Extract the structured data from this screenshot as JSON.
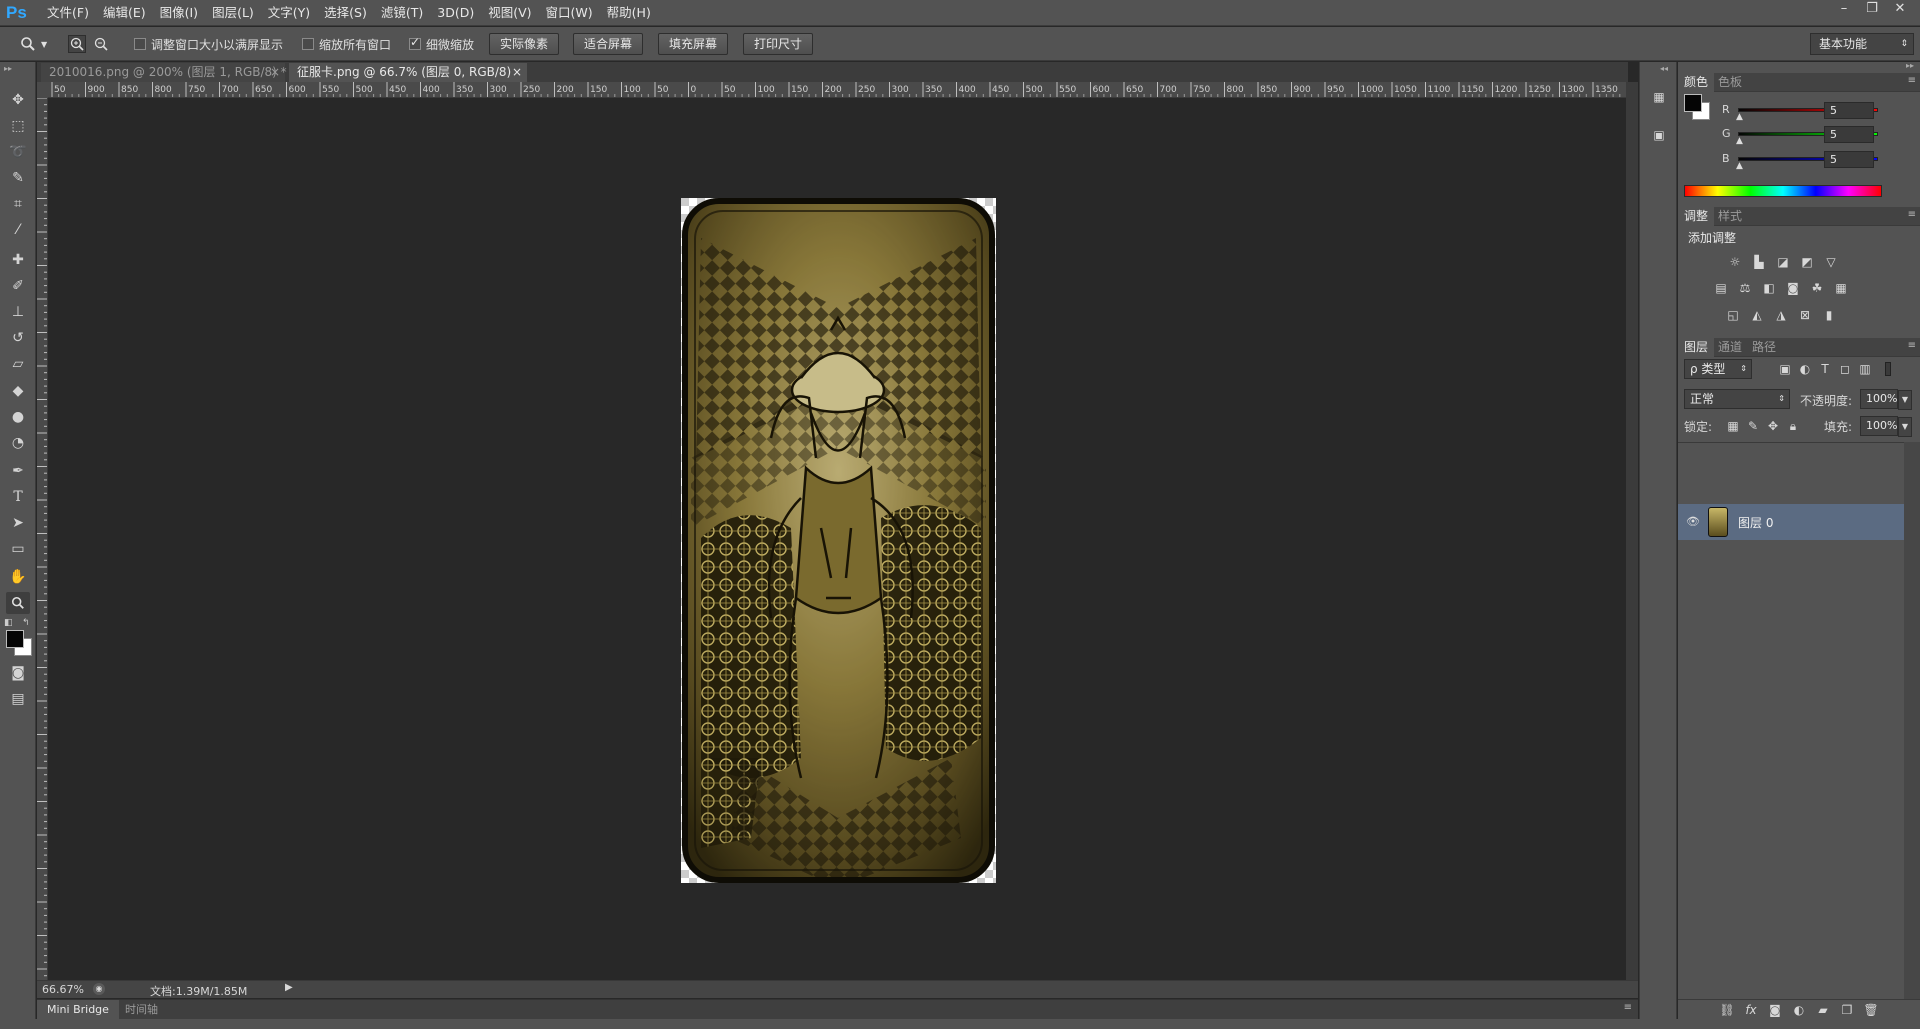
{
  "app": {
    "logo": "Ps"
  },
  "menubar": {
    "items": [
      "文件(F)",
      "编辑(E)",
      "图像(I)",
      "图层(L)",
      "文字(Y)",
      "选择(S)",
      "滤镜(T)",
      "3D(D)",
      "视图(V)",
      "窗口(W)",
      "帮助(H)"
    ],
    "window_controls": [
      "–",
      "❐",
      "✕"
    ]
  },
  "options": {
    "resize_windows": "调整窗口大小以满屏显示",
    "zoom_all_windows": "缩放所有窗口",
    "scrubby_zoom": "细微缩放",
    "actual_pixels": "实际像素",
    "fit_screen": "适合屏幕",
    "fill_screen": "填充屏幕",
    "print_size": "打印尺寸",
    "workspace": "基本功能"
  },
  "tabs": [
    {
      "label": "2010016.png @ 200% (图层 1, RGB/8) *",
      "close": "×"
    },
    {
      "label": "征服卡.png @ 66.7% (图层 0, RGB/8)",
      "close": "×"
    }
  ],
  "ruler": {
    "h_ticks": [
      "50",
      "900",
      "850",
      "800",
      "750",
      "700",
      "650",
      "600",
      "550",
      "500",
      "450",
      "400",
      "350",
      "300",
      "250",
      "200",
      "150",
      "100",
      "50",
      "0",
      "50",
      "100",
      "150",
      "200",
      "250",
      "300",
      "350",
      "400",
      "450",
      "500",
      "550",
      "600",
      "650",
      "700",
      "750",
      "800",
      "850",
      "900",
      "950",
      "1000",
      "1050",
      "1100",
      "1150",
      "1200",
      "1250",
      "1300",
      "1350"
    ]
  },
  "status": {
    "zoom": "66.67%",
    "doc": "文档:1.39M/1.85M"
  },
  "bottom_tabs": [
    "Mini Bridge",
    "时间轴"
  ],
  "color_panel": {
    "tabs": [
      "颜色",
      "色板"
    ],
    "r_label": "R",
    "g_label": "G",
    "b_label": "B",
    "r": "5",
    "g": "5",
    "b": "5"
  },
  "adjust_panel": {
    "tabs": [
      "调整",
      "样式"
    ],
    "title": "添加调整"
  },
  "layers_panel": {
    "tabs": [
      "图层",
      "通道",
      "路径"
    ],
    "filter": "ρ 类型",
    "blend_mode": "正常",
    "opacity_label": "不透明度:",
    "opacity": "100%",
    "lock_label": "锁定:",
    "fill_label": "填充:",
    "fill": "100%",
    "layers": [
      {
        "name": "图层 0"
      }
    ]
  },
  "colors": {
    "accent": "#31a8ff",
    "layer_selected": "#5b6b82"
  }
}
